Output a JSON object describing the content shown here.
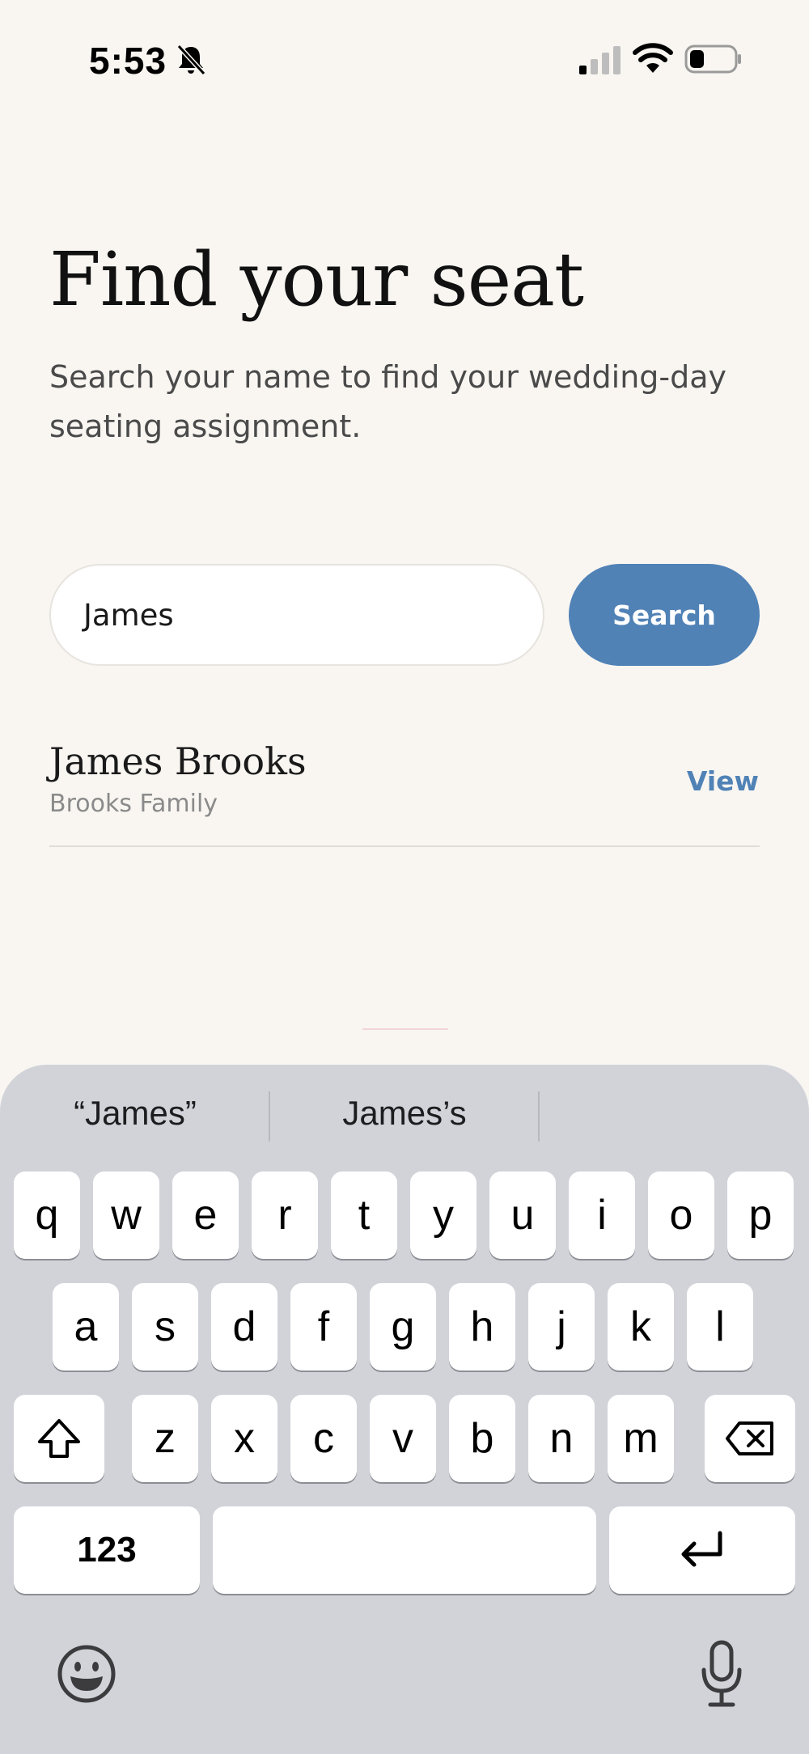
{
  "status_bar": {
    "time": "5:53",
    "icons": [
      "bell-slash-icon",
      "cellular-signal-icon",
      "wifi-icon",
      "battery-icon"
    ]
  },
  "page": {
    "title": "Find your seat",
    "subtitle": "Search your name to find your wedding-day seating assignment."
  },
  "search": {
    "value": "James",
    "button_label": "Search"
  },
  "results": [
    {
      "name": "James Brooks",
      "group": "Brooks Family",
      "action": "View"
    }
  ],
  "keyboard": {
    "suggestions": [
      "“James”",
      "James’s",
      ""
    ],
    "row1": [
      "q",
      "w",
      "e",
      "r",
      "t",
      "y",
      "u",
      "i",
      "o",
      "p"
    ],
    "row2": [
      "a",
      "s",
      "d",
      "f",
      "g",
      "h",
      "j",
      "k",
      "l"
    ],
    "row3": [
      "z",
      "x",
      "c",
      "v",
      "b",
      "n",
      "m"
    ],
    "numbers_label": "123",
    "space_label": "",
    "icons": [
      "shift-icon",
      "backspace-icon",
      "return-icon",
      "emoji-icon",
      "microphone-icon"
    ]
  },
  "colors": {
    "background": "#f9f6f2",
    "accent": "#5082b6",
    "keyboard_bg": "#d1d3d9"
  }
}
